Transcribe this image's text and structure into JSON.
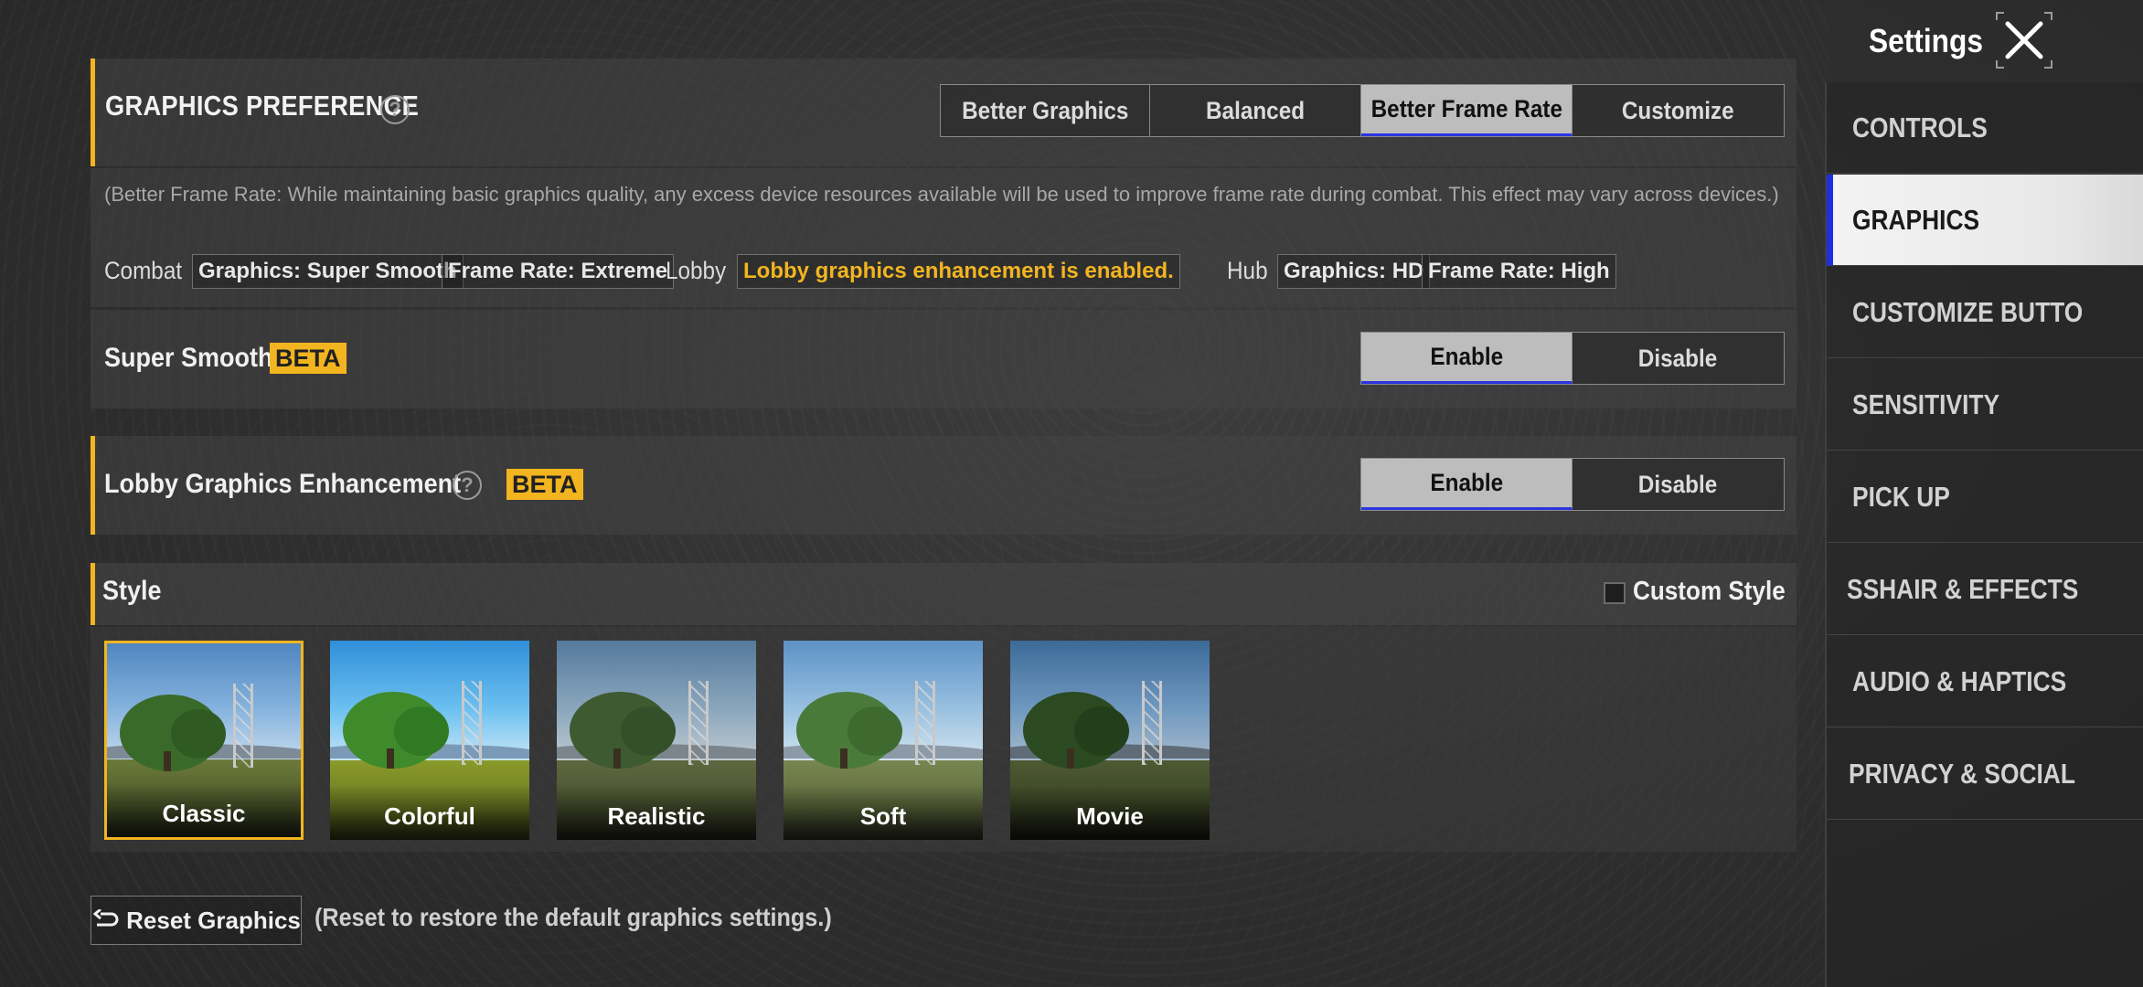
{
  "settings_title": "Settings",
  "graphics_preference": {
    "title": "GRAPHICS PREFERENCE",
    "options": [
      "Better Graphics",
      "Balanced",
      "Better Frame Rate",
      "Customize"
    ],
    "selected": "Better Frame Rate"
  },
  "description": {
    "text": "(Better Frame Rate: While maintaining basic graphics quality, any excess device resources available will be used to improve frame rate during combat. This effect may vary across devices.)",
    "combat_label": "Combat",
    "combat_graphics": "Graphics: Super Smooth",
    "combat_frame_rate": "Frame Rate: Extreme",
    "lobby_label": "Lobby",
    "lobby_status": "Lobby graphics enhancement is enabled.",
    "hub_label": "Hub",
    "hub_graphics": "Graphics: HD",
    "hub_frame_rate": "Frame Rate: High"
  },
  "super_smooth": {
    "title": "Super Smooth",
    "badge": "BETA",
    "enable": "Enable",
    "disable": "Disable",
    "selected": "Enable"
  },
  "lobby_enhancement": {
    "title": "Lobby Graphics Enhancement",
    "badge": "BETA",
    "enable": "Enable",
    "disable": "Disable",
    "selected": "Enable"
  },
  "style": {
    "title": "Style",
    "custom_style_label": "Custom Style",
    "custom_style_checked": false,
    "presets": [
      "Classic",
      "Colorful",
      "Realistic",
      "Soft",
      "Movie"
    ],
    "selected": "Classic"
  },
  "reset": {
    "button_label": "Reset Graphics",
    "note": "(Reset to restore the default graphics settings.)"
  },
  "nav": {
    "items": [
      "CONTROLS",
      "GRAPHICS",
      "CUSTOMIZE BUTTO",
      "SENSITIVITY",
      "PICK UP",
      "SSHAIR & EFFECTS",
      "AUDIO & HAPTICS",
      "PRIVACY & SOCIAL"
    ],
    "selected": "GRAPHICS"
  },
  "colors": {
    "accent_yellow": "#f2b520",
    "selection_blue": "#1f2fe0"
  }
}
